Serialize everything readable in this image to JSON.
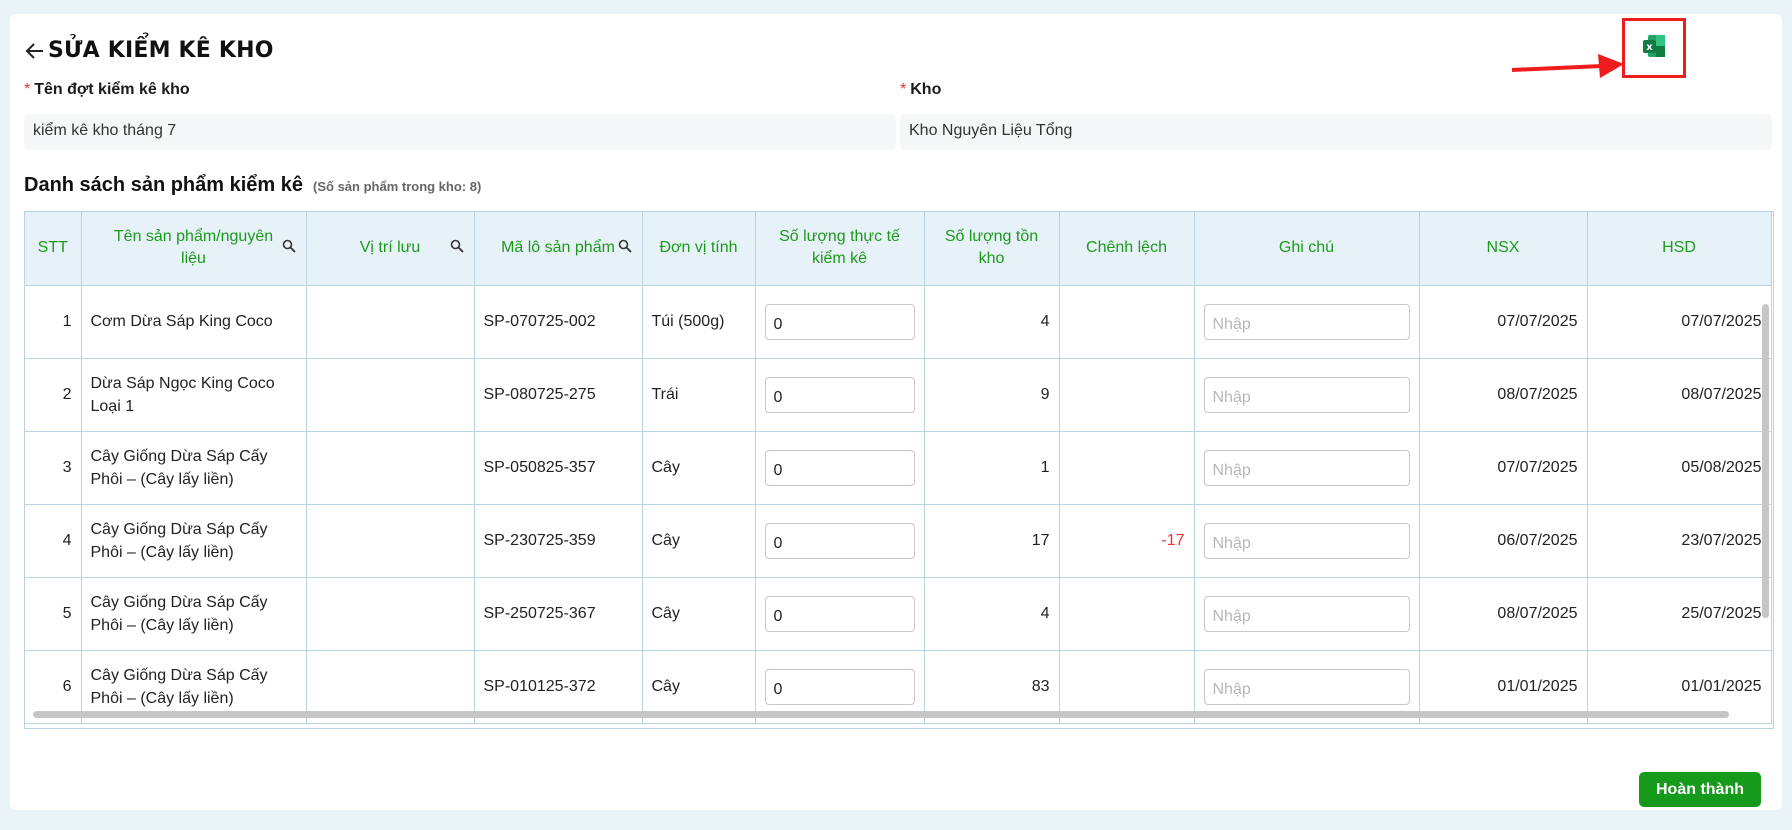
{
  "header": {
    "title": "SỬA KIỂM KÊ KHO"
  },
  "form": {
    "name_label": "Tên đợt kiểm kê kho",
    "name_value": "kiểm kê kho tháng 7",
    "warehouse_label": "Kho",
    "warehouse_value": "Kho Nguyên Liệu Tổng",
    "required_mark": "*"
  },
  "section": {
    "title": "Danh sách sản phẩm kiểm kê",
    "subtitle": "(Số sản phẩm trong kho: 8)"
  },
  "table": {
    "headers": [
      "STT",
      "Tên sản phẩm/nguyên liệu",
      "Vị trí lưu",
      "Mã lô sản phẩm",
      "Đơn vị tính",
      "Số lượng thực tế kiểm kê",
      "Số lượng tồn kho",
      "Chênh lệch",
      "Ghi chú",
      "NSX",
      "HSD"
    ],
    "note_placeholder": "Nhập",
    "rows": [
      {
        "stt": "1",
        "name": "Cơm Dừa Sáp King Coco",
        "location": "",
        "lot": "SP-070725-002",
        "unit": "Túi (500g)",
        "actual": "0",
        "stock": "4",
        "diff": "",
        "nsx": "07/07/2025",
        "hsd": "07/07/2025"
      },
      {
        "stt": "2",
        "name": "Dừa Sáp Ngọc King Coco Loại 1",
        "location": "",
        "lot": "SP-080725-275",
        "unit": "Trái",
        "actual": "0",
        "stock": "9",
        "diff": "",
        "nsx": "08/07/2025",
        "hsd": "08/07/2025"
      },
      {
        "stt": "3",
        "name": "Cây Giống Dừa Sáp Cấy Phôi – (Cây lấy liền)",
        "location": "",
        "lot": "SP-050825-357",
        "unit": "Cây",
        "actual": "0",
        "stock": "1",
        "diff": "",
        "nsx": "07/07/2025",
        "hsd": "05/08/2025"
      },
      {
        "stt": "4",
        "name": "Cây Giống Dừa Sáp Cấy Phôi – (Cây lấy liền)",
        "location": "",
        "lot": "SP-230725-359",
        "unit": "Cây",
        "actual": "0",
        "stock": "17",
        "diff": "-17",
        "nsx": "06/07/2025",
        "hsd": "23/07/2025"
      },
      {
        "stt": "5",
        "name": "Cây Giống Dừa Sáp Cấy Phôi – (Cây lấy liền)",
        "location": "",
        "lot": "SP-250725-367",
        "unit": "Cây",
        "actual": "0",
        "stock": "4",
        "diff": "",
        "nsx": "08/07/2025",
        "hsd": "25/07/2025"
      },
      {
        "stt": "6",
        "name": "Cây Giống Dừa Sáp Cấy Phôi – (Cây lấy liền)",
        "location": "",
        "lot": "SP-010125-372",
        "unit": "Cây",
        "actual": "0",
        "stock": "83",
        "diff": "",
        "nsx": "01/01/2025",
        "hsd": "01/01/2025"
      }
    ]
  },
  "footer": {
    "done_label": "Hoàn thành"
  },
  "colors": {
    "accent_green": "#1c9a1c",
    "annotation_red": "#ee1c1c",
    "excel_green": "#107c41"
  },
  "icons": {
    "back": "arrow-left-icon",
    "excel": "excel-icon",
    "search": "search-icon"
  }
}
